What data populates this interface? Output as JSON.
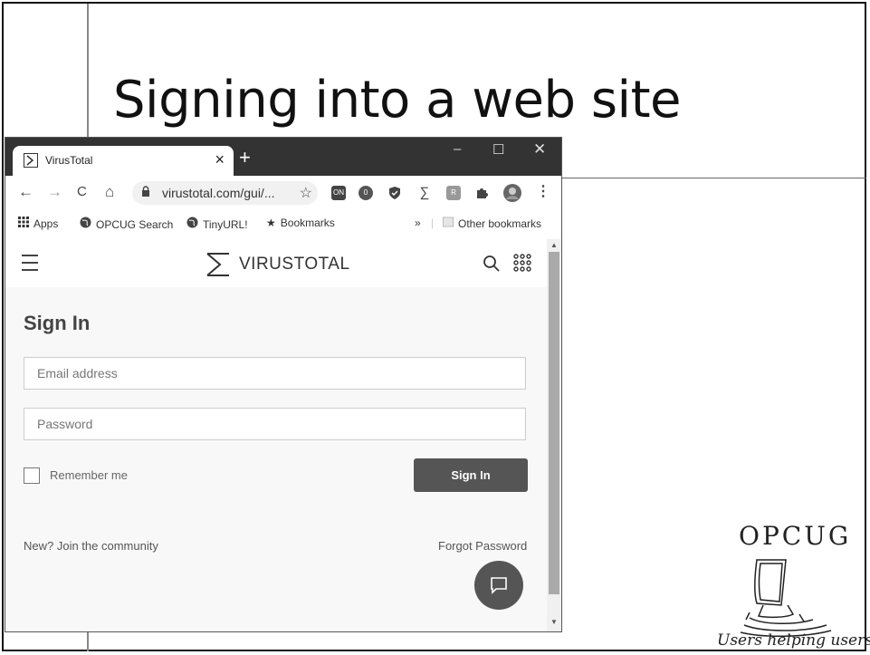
{
  "slide": {
    "title": "Signing into a web site"
  },
  "browser": {
    "tab": {
      "title": "VirusTotal",
      "close_label": "×"
    },
    "new_tab_label": "+",
    "window_controls": {
      "minimize": "–",
      "maximize": "☐",
      "close": "✕"
    },
    "nav": {
      "back": "←",
      "forward": "→",
      "reload": "C",
      "home": "⌂"
    },
    "address": {
      "url": "virustotal.com/gui/...",
      "lock_icon": "lock-icon",
      "star_icon": "star-icon"
    },
    "extensions": [
      {
        "name": "on-extension-icon",
        "label": "ON"
      },
      {
        "name": "shield-badge-icon",
        "label": "0"
      },
      {
        "name": "shield-icon",
        "label": ""
      },
      {
        "name": "virustotal-ext-icon",
        "label": "∑"
      },
      {
        "name": "r-extension-icon",
        "label": "R"
      },
      {
        "name": "puzzle-icon",
        "label": ""
      },
      {
        "name": "profile-avatar",
        "label": ""
      }
    ],
    "menu_label": "⋮",
    "bookmarks": {
      "apps": "Apps",
      "items": [
        "OPCUG Search",
        "TinyURL!",
        "Bookmarks"
      ],
      "overflow": "»",
      "other": "Other bookmarks"
    }
  },
  "site": {
    "logo_text": "VIRUSTOTAL",
    "signin": {
      "title": "Sign In",
      "email_placeholder": "Email address",
      "password_placeholder": "Password",
      "remember_label": "Remember me",
      "button_label": "Sign In",
      "join_link": "New? Join the community",
      "forgot_link": "Forgot Password"
    }
  },
  "opcug": {
    "logo_text": "OPCUG",
    "tagline": "Users helping users"
  },
  "colors": {
    "titlebar": "#333333",
    "button": "#555555",
    "page_bg": "#f8f8f8"
  }
}
